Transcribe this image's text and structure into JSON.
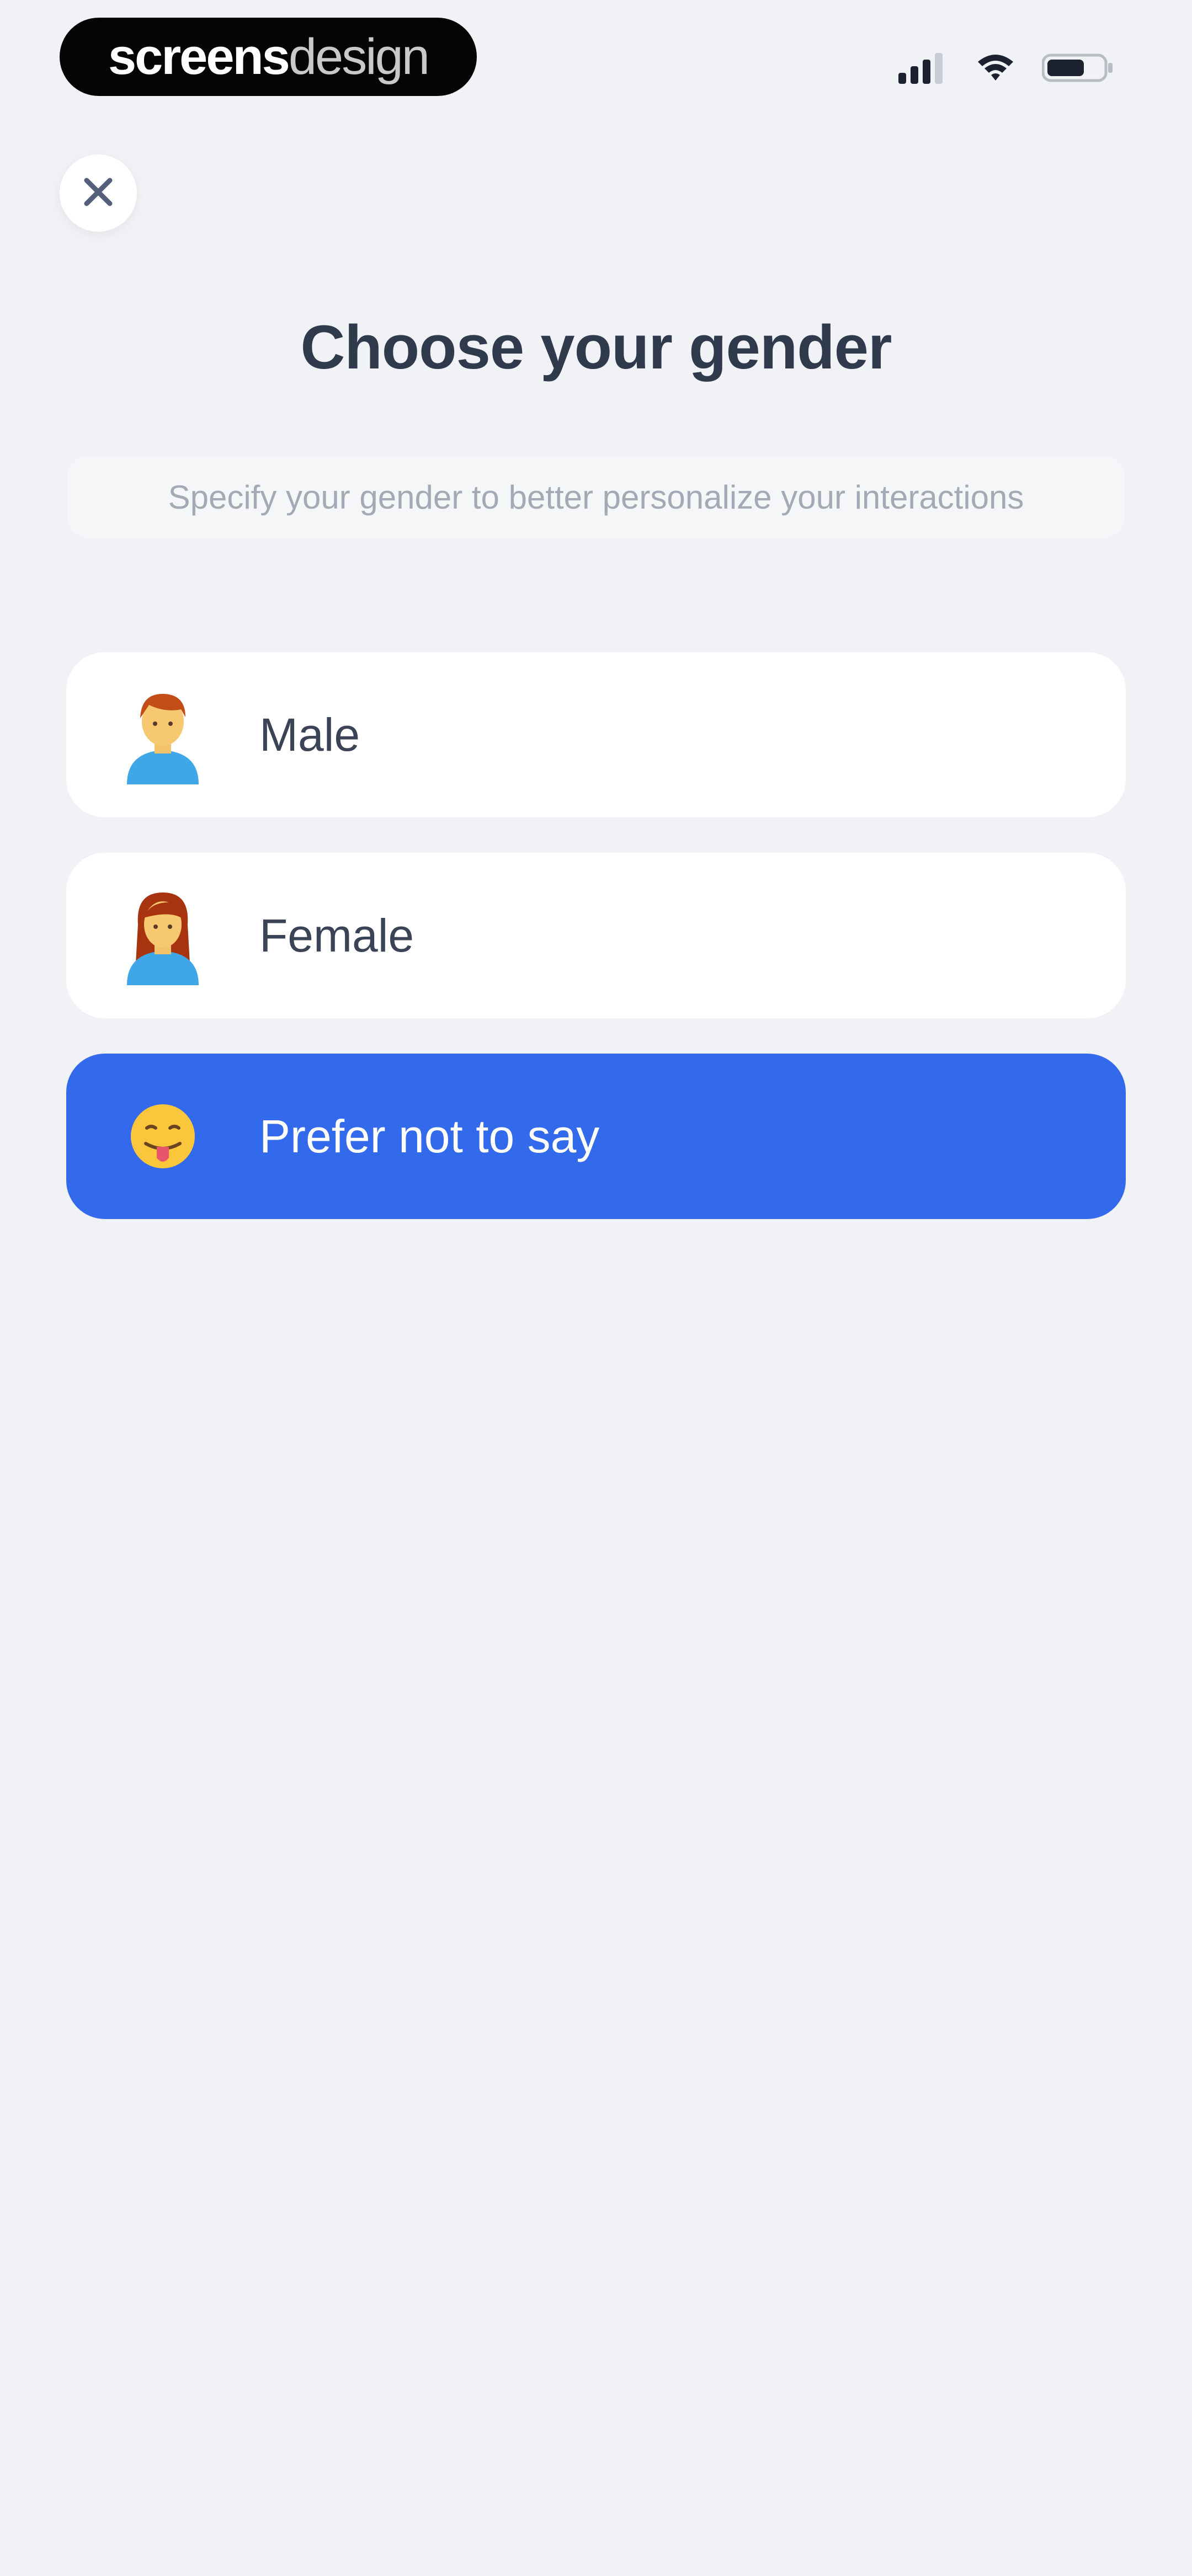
{
  "status_bar": {
    "brand_strong": "screens",
    "brand_light": "design",
    "signal_icon": "cellular-signal-icon",
    "wifi_icon": "wifi-icon",
    "battery_icon": "battery-icon"
  },
  "header": {
    "close_icon": "close-icon"
  },
  "page": {
    "title": "Choose your gender",
    "subtitle": "Specify your gender to better personalize your interactions"
  },
  "options": [
    {
      "label": "Male",
      "icon": "man-emoji-icon",
      "selected": false
    },
    {
      "label": "Female",
      "icon": "woman-emoji-icon",
      "selected": false
    },
    {
      "label": "Prefer not to say",
      "icon": "face-with-tongue-emoji-icon",
      "selected": true
    }
  ],
  "colors": {
    "background": "#f0f2f5",
    "accent": "#326aeb",
    "card": "#ffffff",
    "title": "#2f3a4d",
    "subtitle": "#a3aab5"
  }
}
